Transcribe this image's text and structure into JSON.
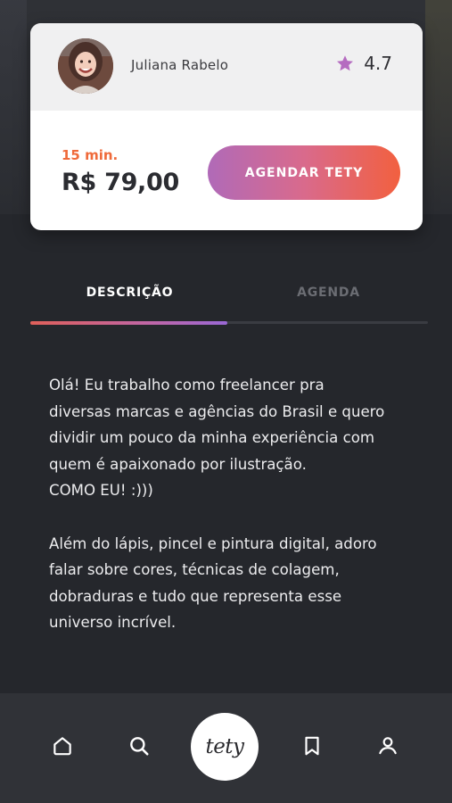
{
  "provider": {
    "name": "Juliana Rabelo",
    "rating": "4.7"
  },
  "offer": {
    "duration": "15 min.",
    "price": "R$ 79,00",
    "cta_label": "AGENDAR TETY"
  },
  "tabs": [
    {
      "label": "DESCRIÇÃO",
      "active": true
    },
    {
      "label": "AGENDA",
      "active": false
    }
  ],
  "description": "Olá! Eu trabalho como freelancer pra\ndiversas marcas e agências do Brasil e quero\ndividir um pouco da minha experiência com\nquem é apaixonado por ilustração.\nCOMO EU! :)))\n\nAlém do lápis, pincel e pintura digital, adoro\nfalar sobre cores, técnicas de colagem,\ndobraduras e tudo que representa esse\nuniverso incrível.",
  "bottom_nav": {
    "center_logo": "tety",
    "icons": [
      "home-icon",
      "search-icon",
      "bookmark-icon",
      "profile-icon"
    ]
  },
  "colors": {
    "background": "#25272c",
    "accent_orange": "#ef6a3a",
    "accent_purple": "#b06ab8",
    "star": "#b56cc0"
  }
}
